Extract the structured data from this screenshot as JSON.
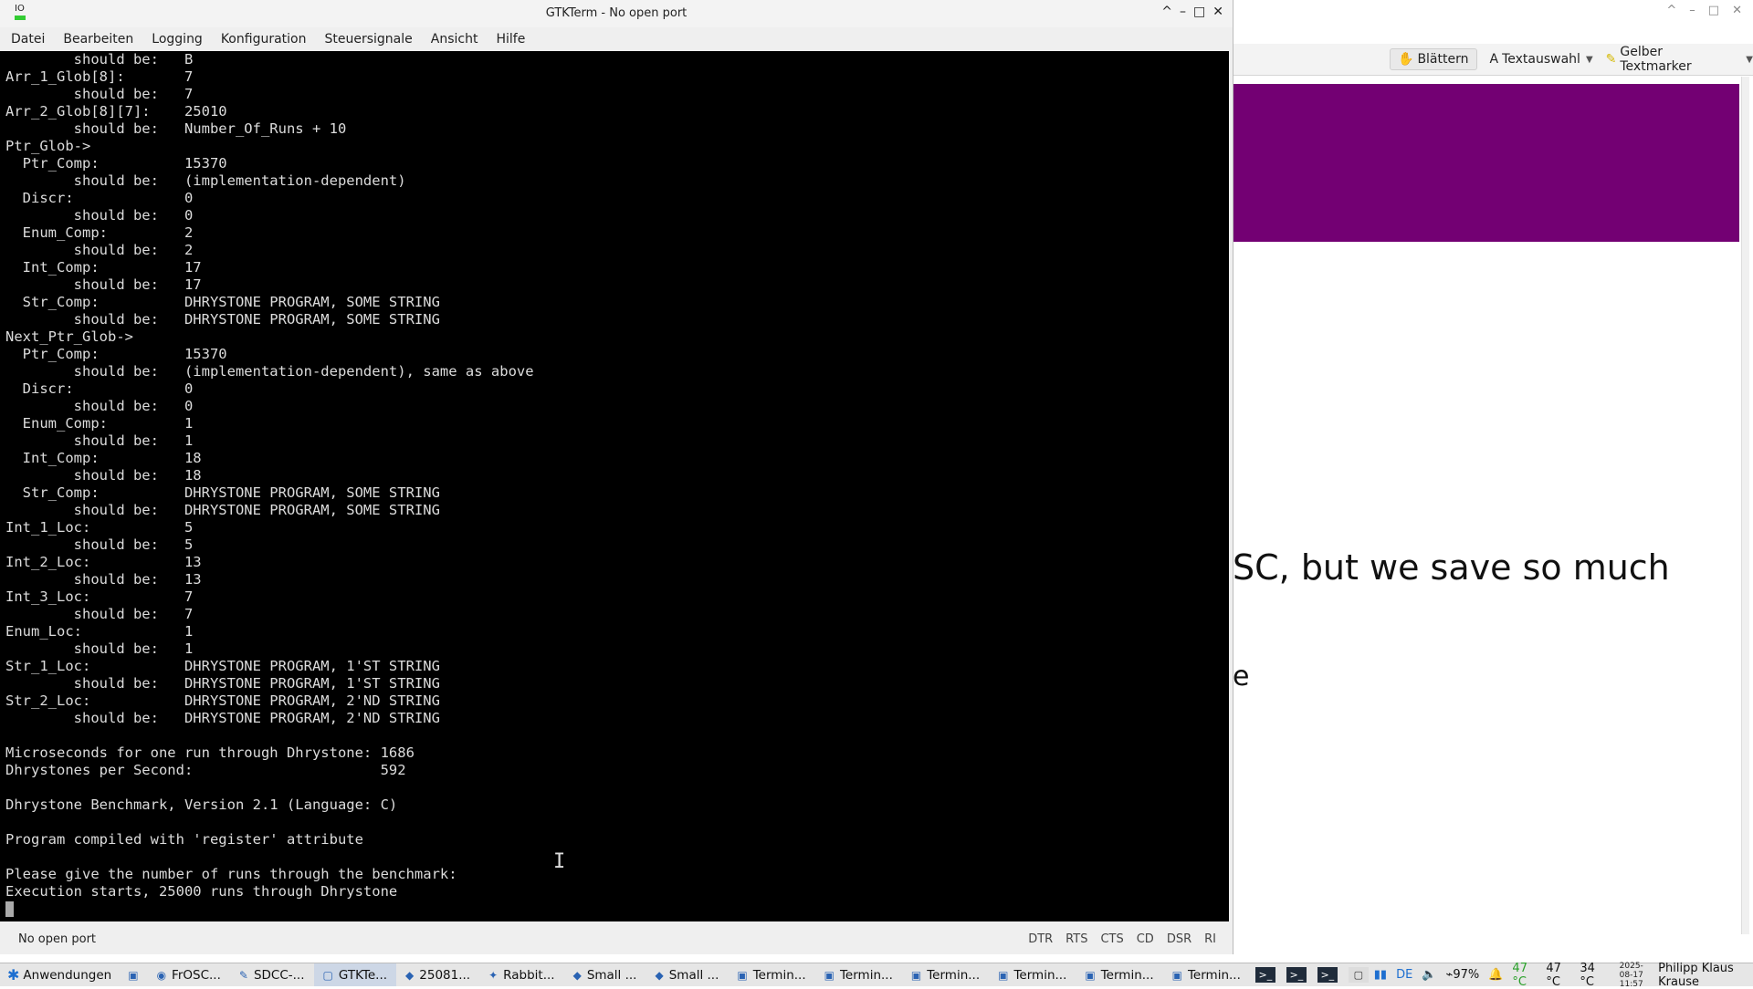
{
  "viewer": {
    "controls": [
      "^",
      "–",
      "□",
      "✕"
    ],
    "toolbar": {
      "scroll_label": "Blättern",
      "select_label": "Textauswahl",
      "highlight_label": "Gelber Textmarker"
    },
    "slide_text": "SC, but we save so much",
    "slide_fragment": "e",
    "colors": {
      "accent": "#730073"
    }
  },
  "window": {
    "title": "GTKTerm - No open port",
    "icon_label": "IO",
    "controls": [
      "^",
      "–",
      "□",
      "✕"
    ]
  },
  "menu": [
    "Datei",
    "Bearbeiten",
    "Logging",
    "Konfiguration",
    "Steuersignale",
    "Ansicht",
    "Hilfe"
  ],
  "terminal": {
    "lines": [
      "        should be:   B",
      "Arr_1_Glob[8]:       7",
      "        should be:   7",
      "Arr_2_Glob[8][7]:    25010",
      "        should be:   Number_Of_Runs + 10",
      "Ptr_Glob->",
      "  Ptr_Comp:          15370",
      "        should be:   (implementation-dependent)",
      "  Discr:             0",
      "        should be:   0",
      "  Enum_Comp:         2",
      "        should be:   2",
      "  Int_Comp:          17",
      "        should be:   17",
      "  Str_Comp:          DHRYSTONE PROGRAM, SOME STRING",
      "        should be:   DHRYSTONE PROGRAM, SOME STRING",
      "Next_Ptr_Glob->",
      "  Ptr_Comp:          15370",
      "        should be:   (implementation-dependent), same as above",
      "  Discr:             0",
      "        should be:   0",
      "  Enum_Comp:         1",
      "        should be:   1",
      "  Int_Comp:          18",
      "        should be:   18",
      "  Str_Comp:          DHRYSTONE PROGRAM, SOME STRING",
      "        should be:   DHRYSTONE PROGRAM, SOME STRING",
      "Int_1_Loc:           5",
      "        should be:   5",
      "Int_2_Loc:           13",
      "        should be:   13",
      "Int_3_Loc:           7",
      "        should be:   7",
      "Enum_Loc:            1",
      "        should be:   1",
      "Str_1_Loc:           DHRYSTONE PROGRAM, 1'ST STRING",
      "        should be:   DHRYSTONE PROGRAM, 1'ST STRING",
      "Str_2_Loc:           DHRYSTONE PROGRAM, 2'ND STRING",
      "        should be:   DHRYSTONE PROGRAM, 2'ND STRING",
      "",
      "Microseconds for one run through Dhrystone: 1686",
      "Dhrystones per Second:                      592",
      "",
      "Dhrystone Benchmark, Version 2.1 (Language: C)",
      "",
      "Program compiled with 'register' attribute",
      "",
      "Please give the number of runs through the benchmark:",
      "Execution starts, 25000 runs through Dhrystone"
    ]
  },
  "status": {
    "text": "No open port",
    "signals": [
      "DTR",
      "RTS",
      "CTS",
      "CD",
      "DSR",
      "RI"
    ]
  },
  "taskbar": {
    "start_label": "Anwendungen",
    "tasks": [
      "FrOSC...",
      "SDCC-...",
      "GTKTe...",
      "25081...",
      "Rabbit...",
      "Small ...",
      "Small ...",
      "Termin...",
      "Termin...",
      "Termin...",
      "Termin...",
      "Termin...",
      "Termin..."
    ],
    "tray": {
      "keyboard": "DE",
      "battery": "97%",
      "temp1": "47 °C",
      "temp2": "47 °C",
      "temp3": "34 °C",
      "date": "2025-08-17",
      "time": "11:57",
      "user": "Philipp Klaus Krause"
    }
  }
}
